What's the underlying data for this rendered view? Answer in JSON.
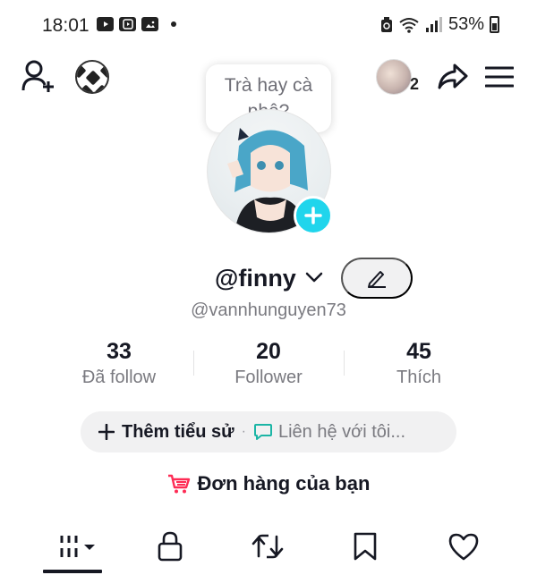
{
  "status_bar": {
    "time": "18:01",
    "battery": "53%",
    "icons": [
      "youtube-icon",
      "play-icon",
      "gallery-icon",
      "dot-icon",
      "recycle-icon",
      "wifi-icon",
      "signal-icon",
      "battery-icon"
    ]
  },
  "header": {
    "bubble_text": "Trà hay cà phê?",
    "friends_count": "2",
    "icons": [
      "add-user-icon",
      "soccer-ball-icon",
      "share-icon",
      "menu-icon"
    ]
  },
  "profile": {
    "username": "@finny",
    "handle": "@vannhunguyen73"
  },
  "stats": [
    {
      "value": "33",
      "label": "Đã follow"
    },
    {
      "value": "20",
      "label": "Follower"
    },
    {
      "value": "45",
      "label": "Thích"
    }
  ],
  "bio": {
    "add_label": "Thêm tiểu sử",
    "separator": "·",
    "contact_label": "Liên hệ với tôi..."
  },
  "orders": {
    "label": "Đơn hàng của bạn"
  },
  "tabs": [
    {
      "name": "videos",
      "icon": "grid-icon",
      "selected": true
    },
    {
      "name": "private",
      "icon": "lock-icon"
    },
    {
      "name": "reposts",
      "icon": "repost-icon"
    },
    {
      "name": "favorites",
      "icon": "bookmark-icon"
    },
    {
      "name": "liked",
      "icon": "heart-icon"
    }
  ],
  "colors": {
    "accent": "#20d5ec",
    "cart": "#fe2c55",
    "chat": "#1bb5a5",
    "text": "#161823",
    "muted": "#7a7a80",
    "pill_bg": "#f1f1f2"
  }
}
